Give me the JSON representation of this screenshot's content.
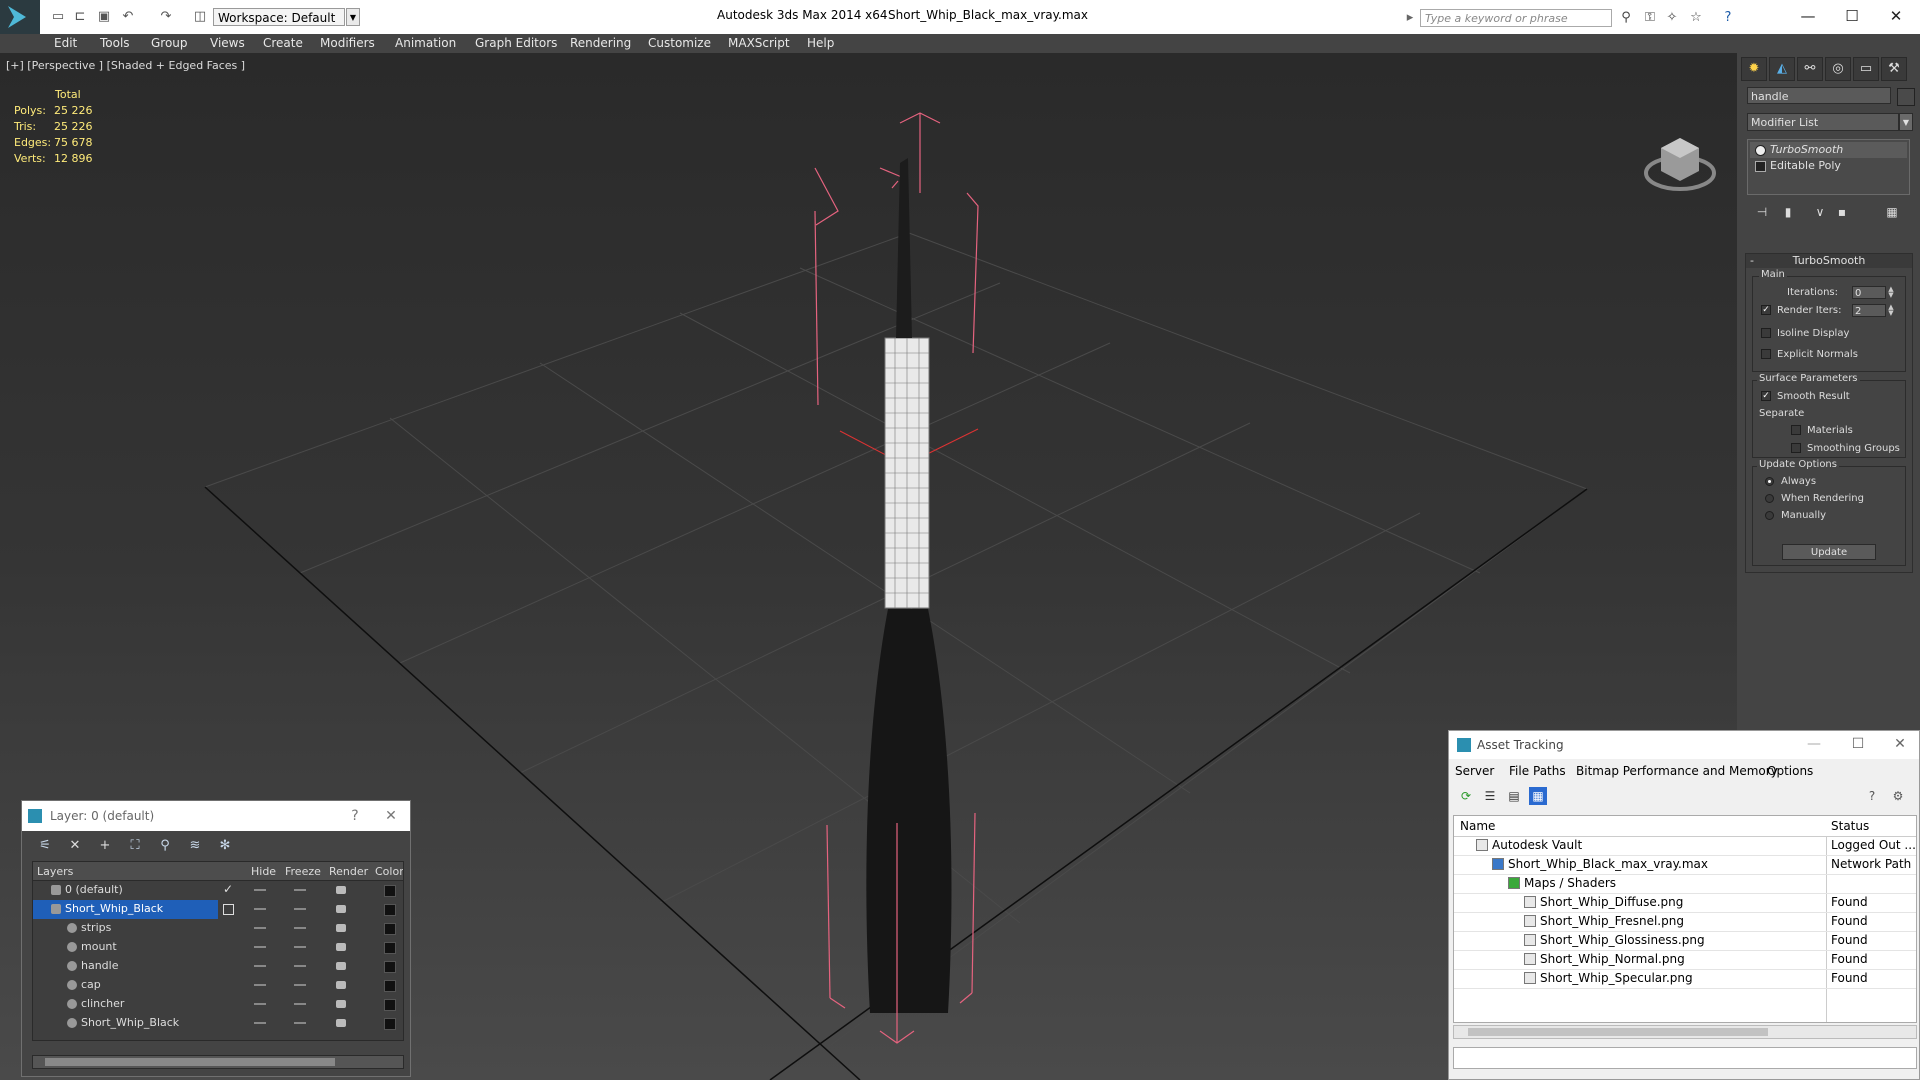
{
  "titlebar": {
    "workspace": "Workspace: Default",
    "app_title": "Autodesk 3ds Max  2014 x64",
    "file_title": "Short_Whip_Black_max_vray.max",
    "search_placeholder": "Type a keyword or phrase"
  },
  "menu": [
    "Edit",
    "Tools",
    "Group",
    "Views",
    "Create",
    "Modifiers",
    "Animation",
    "Graph Editors",
    "Rendering",
    "Customize",
    "MAXScript",
    "Help"
  ],
  "viewport": {
    "label": "[+] [Perspective ] [Shaded + Edged Faces ]",
    "stats": {
      "header": "Total",
      "rows": [
        {
          "label": "Polys:",
          "value": "25 226"
        },
        {
          "label": "Tris:",
          "value": "25 226"
        },
        {
          "label": "Edges:",
          "value": "75 678"
        },
        {
          "label": "Verts:",
          "value": "12 896"
        }
      ]
    }
  },
  "command_panel": {
    "object_name": "handle",
    "modifier_list": "Modifier List",
    "stack": [
      "TurboSmooth",
      "Editable Poly"
    ],
    "rollout": {
      "title": "TurboSmooth",
      "main_label": "Main",
      "iterations_label": "Iterations:",
      "iterations_value": "0",
      "render_iters_label": "Render Iters:",
      "render_iters_value": "2",
      "isoline_label": "Isoline Display",
      "explicit_normals_label": "Explicit Normals",
      "surface_label": "Surface Parameters",
      "smooth_result_label": "Smooth Result",
      "separate_label": "Separate",
      "materials_label": "Materials",
      "smoothing_groups_label": "Smoothing Groups",
      "update_options_label": "Update Options",
      "always_label": "Always",
      "when_rendering_label": "When Rendering",
      "manually_label": "Manually",
      "update_button": "Update"
    }
  },
  "layer_dialog": {
    "title": "Layer: 0 (default)",
    "help": "?",
    "columns": [
      "Layers",
      "Hide",
      "Freeze",
      "Render",
      "Color"
    ],
    "rows": [
      {
        "name": "0 (default)",
        "indent": 1,
        "selected": false
      },
      {
        "name": "Short_Whip_Black",
        "indent": 1,
        "selected": true
      },
      {
        "name": "strips",
        "indent": 2,
        "selected": false
      },
      {
        "name": "mount",
        "indent": 2,
        "selected": false
      },
      {
        "name": "handle",
        "indent": 2,
        "selected": false
      },
      {
        "name": "cap",
        "indent": 2,
        "selected": false
      },
      {
        "name": "clincher",
        "indent": 2,
        "selected": false
      },
      {
        "name": "Short_Whip_Black",
        "indent": 2,
        "selected": false
      }
    ]
  },
  "asset_dialog": {
    "title": "Asset Tracking",
    "menu": [
      "Server",
      "File",
      "Paths",
      "Bitmap Performance and Memory",
      "Options"
    ],
    "columns": [
      "Name",
      "Status"
    ],
    "rows": [
      {
        "name": "Autodesk Vault",
        "status": "Logged Out ...",
        "indent": 1
      },
      {
        "name": "Short_Whip_Black_max_vray.max",
        "status": "Network Path",
        "indent": 2
      },
      {
        "name": "Maps / Shaders",
        "status": "",
        "indent": 3
      },
      {
        "name": "Short_Whip_Diffuse.png",
        "status": "Found",
        "indent": 4
      },
      {
        "name": "Short_Whip_Fresnel.png",
        "status": "Found",
        "indent": 4
      },
      {
        "name": "Short_Whip_Glossiness.png",
        "status": "Found",
        "indent": 4
      },
      {
        "name": "Short_Whip_Normal.png",
        "status": "Found",
        "indent": 4
      },
      {
        "name": "Short_Whip_Specular.png",
        "status": "Found",
        "indent": 4
      }
    ]
  },
  "colors": {
    "selection": "#ff6a8a",
    "stats_text": "#ffeb7a",
    "layer_selected": "#1f5fb8"
  }
}
